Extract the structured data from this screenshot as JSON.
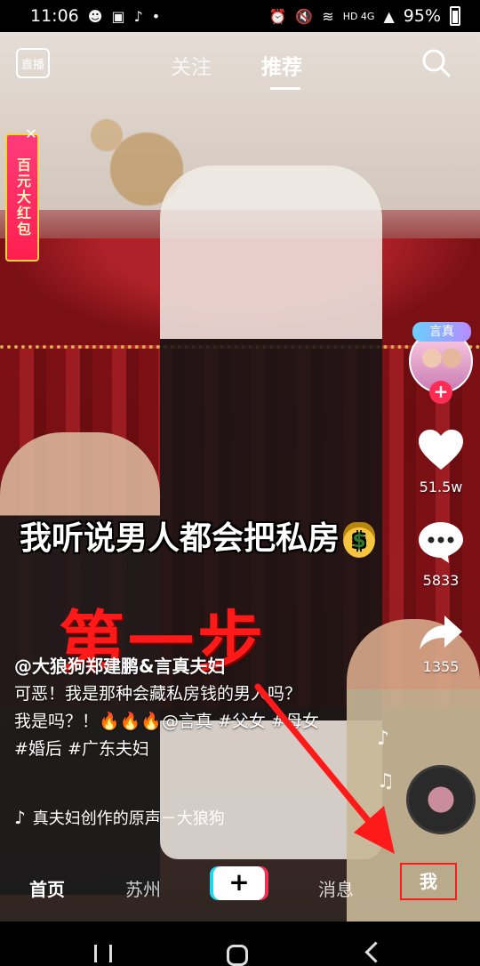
{
  "status_bar": {
    "time": "11:06",
    "battery": "95%",
    "network": "HD 4G",
    "icons": [
      "kakao-icon",
      "image-icon",
      "tiktok-icon",
      "dot-icon",
      "alarm-icon",
      "mute-icon",
      "wifi-icon",
      "signal-icon",
      "battery-icon"
    ]
  },
  "top_nav": {
    "live_label": "直播",
    "tabs": [
      {
        "label": "关注",
        "active": false
      },
      {
        "label": "推荐",
        "active": true
      }
    ]
  },
  "promo": {
    "label": "百元大红包"
  },
  "video": {
    "caption_overlay": "我听说男人都会把私房",
    "step_label": "第一步"
  },
  "right_rail": {
    "avatar_tag": "言真",
    "likes": "51.5w",
    "comments": "5833",
    "shares": "1355"
  },
  "description": {
    "author": "@大狼狗郑建鹏&言真夫妇",
    "line1": "可恶！我是那种会藏私房钱的男人吗？",
    "line2": "我是吗？！🔥🔥🔥@言真 #父女 #母女",
    "line3": "#婚后 #广东夫妇"
  },
  "music": {
    "title": "真夫妇创作的原声－大狼狗"
  },
  "bottom_nav": {
    "home": "首页",
    "city": "苏州",
    "create": "+",
    "messages": "消息",
    "me": "我"
  },
  "colors": {
    "accent_red": "#ff1a1a",
    "tiktok_pink": "#fe2c55",
    "tiktok_cyan": "#20d5ec"
  }
}
